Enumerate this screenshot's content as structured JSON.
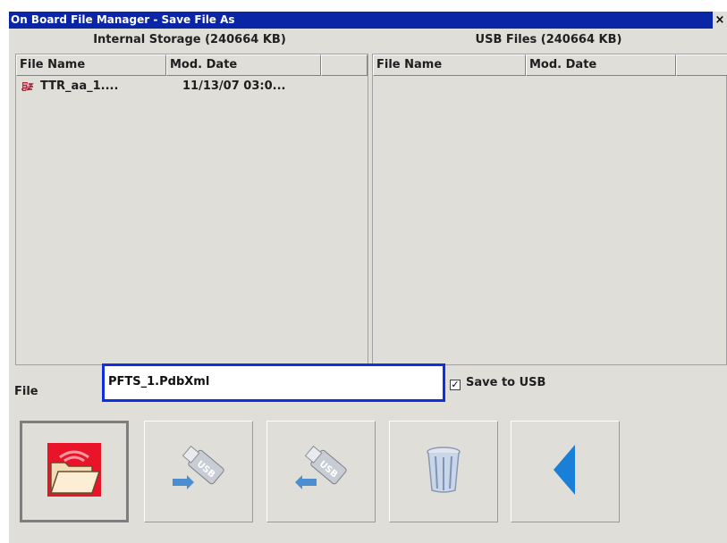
{
  "window": {
    "title": "On Board File Manager - Save File As",
    "close_glyph": "×"
  },
  "internal": {
    "header": "Internal Storage (240664 KB)",
    "columns": [
      "File Name",
      "Mod. Date",
      ""
    ],
    "rows": [
      {
        "icon": "ttr-file-icon",
        "name": "TTR_aa_1....",
        "date": "11/13/07 03:0..."
      }
    ]
  },
  "usb": {
    "header": "USB Files (240664 KB)",
    "columns": [
      "File Name",
      "Mod. Date",
      ""
    ],
    "rows": []
  },
  "file": {
    "label": "File",
    "value": "PFTS_1.PdbXml"
  },
  "save_to_usb": {
    "label": "Save to USB",
    "checked": true,
    "check_glyph": "✓"
  },
  "toolbar": {
    "buttons": [
      {
        "name": "open-folder-button",
        "icon": "folder-icon",
        "pressed": true
      },
      {
        "name": "copy-to-usb-button",
        "icon": "usb-drive-in-icon",
        "pressed": false
      },
      {
        "name": "copy-from-usb-button",
        "icon": "usb-drive-out-icon",
        "pressed": false
      },
      {
        "name": "delete-button",
        "icon": "trash-icon",
        "pressed": false
      },
      {
        "name": "back-button",
        "icon": "back-arrow-icon",
        "pressed": false
      }
    ]
  },
  "colors": {
    "titlebar": "#0a26a6",
    "input_border": "#1030e0",
    "accent_blue": "#1a7fd6",
    "folder_bg": "#e8152a"
  }
}
